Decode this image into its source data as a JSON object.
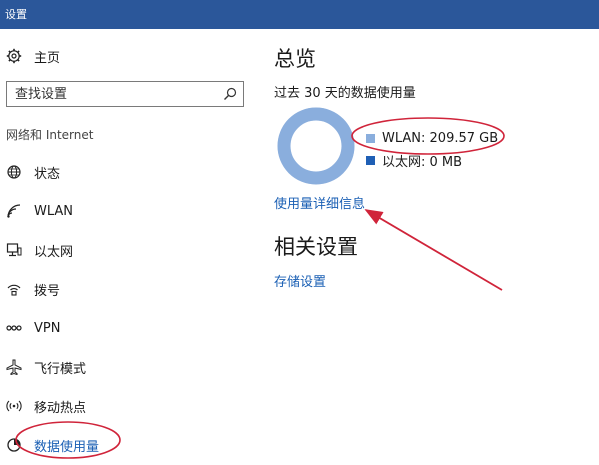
{
  "window": {
    "title": "设置"
  },
  "sidebar": {
    "home_label": "主页",
    "search_placeholder": "查找设置",
    "section_label": "网络和 Internet",
    "items": [
      {
        "label": "状态",
        "icon": "globe-icon"
      },
      {
        "label": "WLAN",
        "icon": "wifi-icon"
      },
      {
        "label": "以太网",
        "icon": "ethernet-icon"
      },
      {
        "label": "拨号",
        "icon": "dialup-icon"
      },
      {
        "label": "VPN",
        "icon": "vpn-icon"
      },
      {
        "label": "飞行模式",
        "icon": "airplane-icon"
      },
      {
        "label": "移动热点",
        "icon": "hotspot-icon"
      },
      {
        "label": "数据使用量",
        "icon": "data-usage-icon",
        "active": true
      }
    ]
  },
  "main": {
    "title": "总览",
    "subtitle": "过去 30 天的数据使用量",
    "usage": [
      {
        "label": "WLAN: 209.57 GB",
        "fraction": 1.0
      },
      {
        "label": "以太网: 0 MB",
        "fraction": 0.0
      }
    ],
    "details_link": "使用量详细信息",
    "related_title": "相关设置",
    "storage_link": "存储设置"
  },
  "colors": {
    "titlebar": "#2b579a",
    "accent": "#1a5fb4",
    "wlan": "#8aaedd",
    "ethernet": "#1f5fb5",
    "annotation": "#d0243a"
  }
}
